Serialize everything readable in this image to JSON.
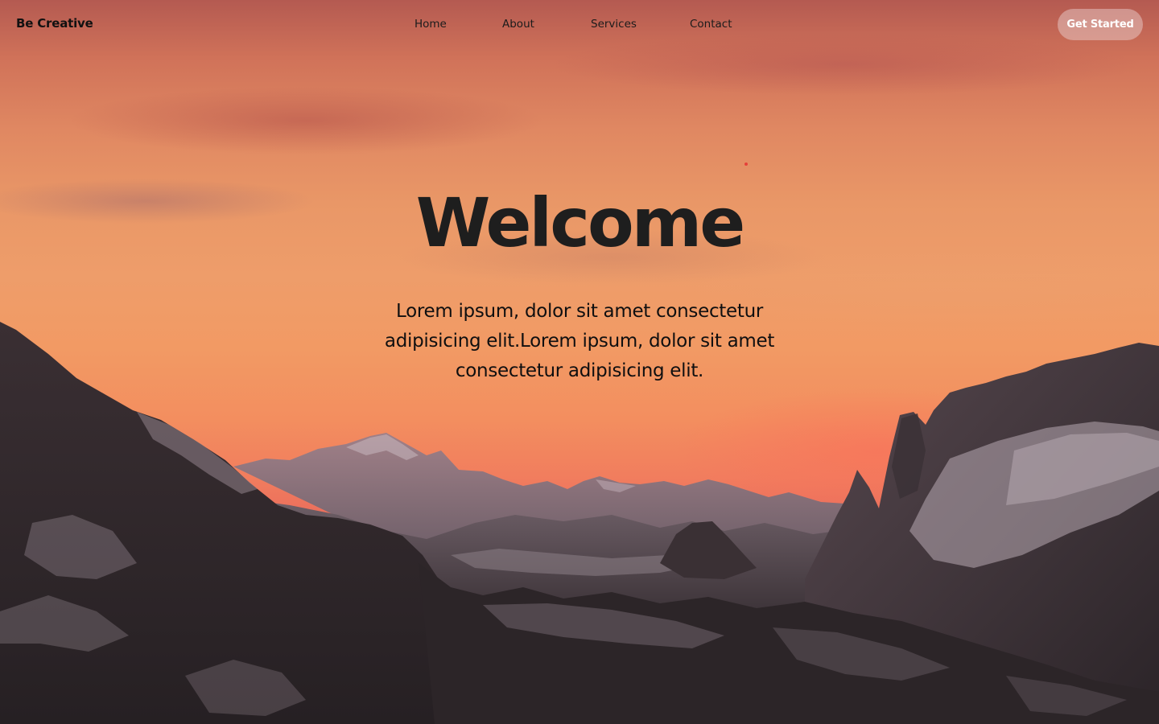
{
  "brand": {
    "name": "Be Creative"
  },
  "nav": {
    "items": [
      {
        "label": "Home"
      },
      {
        "label": "About"
      },
      {
        "label": "Services"
      },
      {
        "label": "Contact"
      }
    ]
  },
  "header": {
    "cta_label": "Get Started"
  },
  "hero": {
    "title": "Welcome",
    "text": "Lorem ipsum, dolor sit amet consectetur adipisicing elit.Lorem ipsum, dolor sit amet consectetur adipisicing elit."
  },
  "colors": {
    "sky_top": "#b45a51",
    "sky_mid": "#ee9d6a",
    "sky_horizon": "#f17d5e",
    "mountain_dark": "#2a2327",
    "snow": "#8f8188",
    "title_text": "#1e1e1e",
    "button_text": "#ffffff"
  }
}
